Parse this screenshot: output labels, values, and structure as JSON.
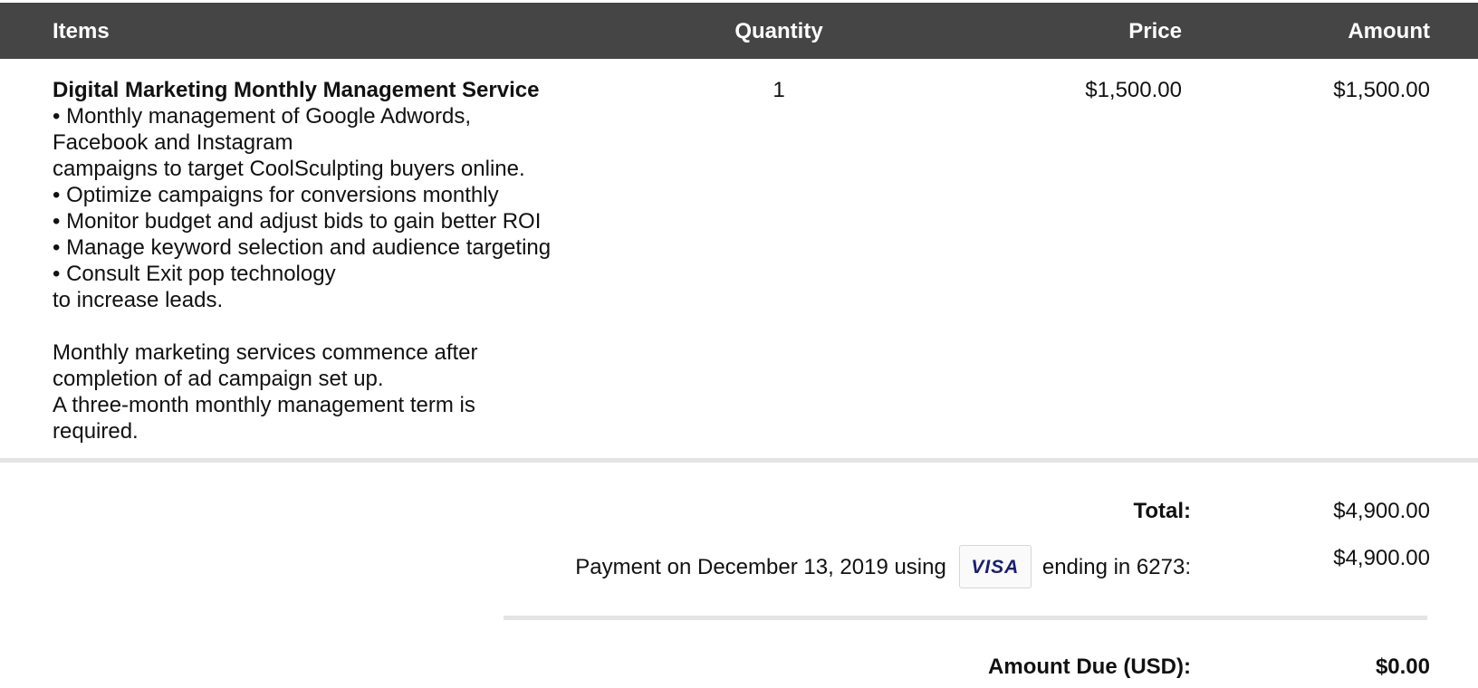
{
  "table": {
    "headers": {
      "items": "Items",
      "quantity": "Quantity",
      "price": "Price",
      "amount": "Amount"
    },
    "rows": [
      {
        "title": "Digital Marketing Monthly Management Service",
        "description": [
          "• Monthly management of Google Adwords,",
          "Facebook and Instagram",
          "campaigns to target CoolSculpting buyers online.",
          "• Optimize campaigns for conversions monthly",
          "• Monitor budget and adjust bids to gain better ROI",
          "• Manage keyword selection and audience targeting",
          "• Consult Exit pop technology",
          "to increase leads.",
          "",
          "Monthly marketing services commence after",
          "completion of ad campaign set up.",
          "A three-month monthly management term is",
          "required."
        ],
        "quantity": "1",
        "price": "$1,500.00",
        "amount": "$1,500.00"
      }
    ]
  },
  "summary": {
    "total_label": "Total:",
    "total_value": "$4,900.00",
    "payment_prefix": "Payment on December 13, 2019 using",
    "card_brand": "VISA",
    "payment_suffix": "ending in 6273:",
    "payment_value": "$4,900.00",
    "amount_due_label": "Amount Due (USD):",
    "amount_due_value": "$0.00"
  },
  "colors": {
    "header_bg": "#454545",
    "header_text": "#ffffff",
    "divider": "#e4e4e4",
    "visa_blue": "#1a1f71"
  }
}
